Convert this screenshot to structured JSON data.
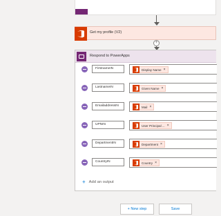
{
  "flow": {
    "get_profile_step": {
      "title": "Get my profile (V2)",
      "icon": "office365-icon",
      "color": "#d83b01"
    },
    "add_action_symbol": "+",
    "respond_step": {
      "title": "Respond to PowerApps",
      "icon": "powerapps-icon",
      "color": "#742774",
      "outputs": [
        {
          "name": "FirstnameIN",
          "value": "Display Name"
        },
        {
          "name": "LastnameIN",
          "value": "Given Name"
        },
        {
          "name": "EmailaddressIN",
          "value": "Mail"
        },
        {
          "name": "UPNIN",
          "value": "User Principal ..."
        },
        {
          "name": "DepartmentIN",
          "value": "Department"
        },
        {
          "name": "CountryIN",
          "value": "Country"
        }
      ],
      "token_remove_symbol": "×",
      "add_output_symbol": "+",
      "add_output_label": "Add an output"
    }
  },
  "footer": {
    "new_step_label": "+ New step",
    "save_label": "Save"
  }
}
